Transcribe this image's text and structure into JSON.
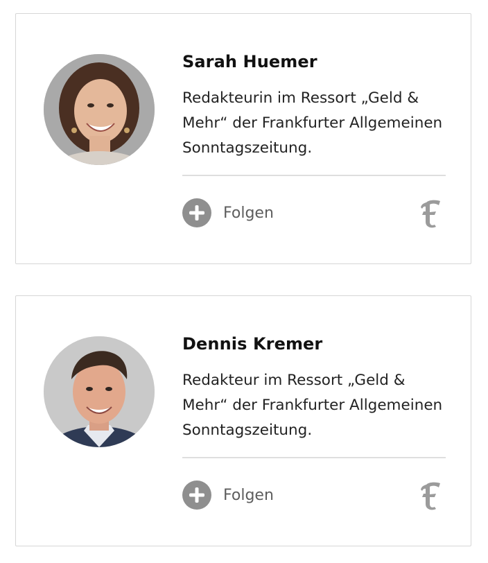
{
  "authors": [
    {
      "name": "Sarah Huemer",
      "description": "Redakteurin im Ressort „Geld & Mehr“ der Frankfurter Allgemeinen Sonntagszeitung.",
      "follow_label": "Folgen",
      "follow_icon": "plus-circle-icon",
      "logo_icon": "faz-logo-icon",
      "avatar": "author-photo"
    },
    {
      "name": "Dennis Kremer",
      "description": "Redakteur im Ressort „Geld & Mehr“ der Frankfurter Allgemeinen Sonntagszeitung.",
      "follow_label": "Folgen",
      "follow_icon": "plus-circle-icon",
      "logo_icon": "faz-logo-icon",
      "avatar": "author-photo"
    }
  ],
  "colors": {
    "icon_gray": "#8f8f8f",
    "label_gray": "#5d5d5d",
    "border": "#d6d6d6",
    "text": "#1f1f1f"
  }
}
